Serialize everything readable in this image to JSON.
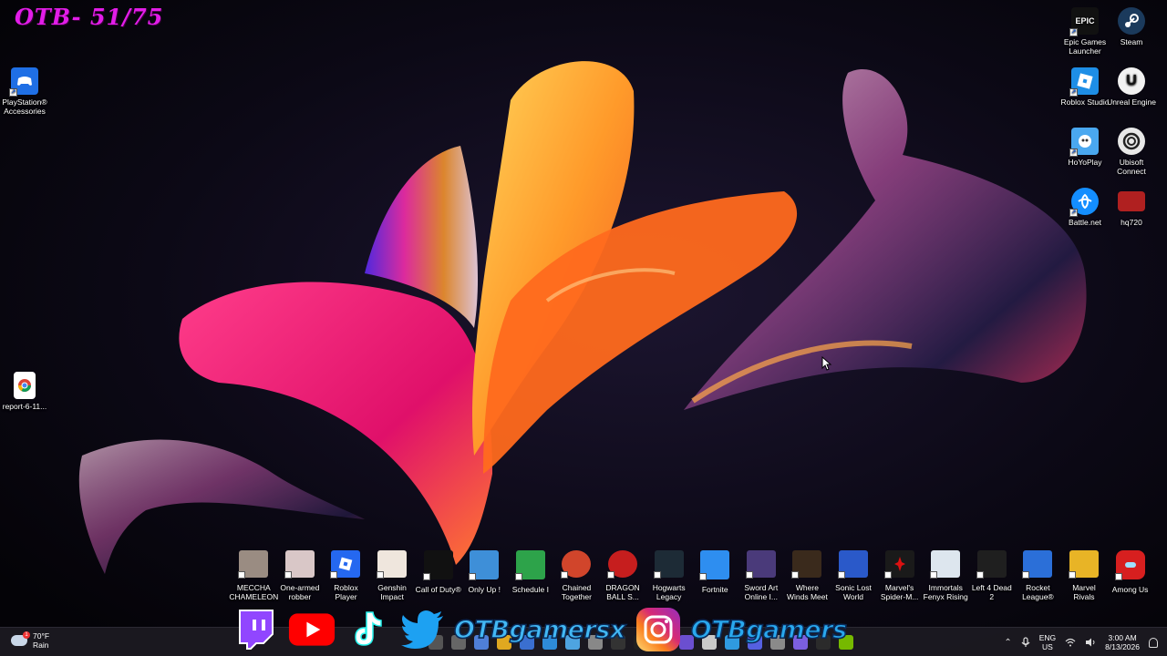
{
  "overlay": {
    "counter": "OTB- 51/75"
  },
  "desktop_left": [
    {
      "label": "PlayStation® Accessories",
      "icon": "playstation-accessories-icon",
      "color": "#1f6fe5"
    },
    {
      "label": "report-6-11...",
      "icon": "chrome-document-icon",
      "color": "#ffffff"
    }
  ],
  "desktop_right": [
    {
      "label": "Epic Games Launcher",
      "icon": "epic-games-icon",
      "color": "#111111",
      "glyph": "EPIC"
    },
    {
      "label": "Steam",
      "icon": "steam-icon",
      "color": "#1b3a5c",
      "glyph": ""
    },
    {
      "label": "Roblox Studio",
      "icon": "roblox-studio-icon",
      "color": "#1e8ee6",
      "glyph": ""
    },
    {
      "label": "Unreal Engine",
      "icon": "unreal-engine-icon",
      "color": "#f2f2f2",
      "glyph": "U"
    },
    {
      "label": "HoYoPlay",
      "icon": "hoyoplay-icon",
      "color": "#4aa8f0",
      "glyph": ""
    },
    {
      "label": "Ubisoft Connect",
      "icon": "ubisoft-connect-icon",
      "color": "#e8e8e8",
      "glyph": ""
    },
    {
      "label": "Battle.net",
      "icon": "battlenet-icon",
      "color": "#148eff",
      "glyph": ""
    },
    {
      "label": "hq720",
      "icon": "image-thumbnail-icon",
      "color": "#b02020",
      "glyph": ""
    }
  ],
  "games": [
    {
      "label": "MECCHA CHAMELEON",
      "icon": "meccha-chameleon-icon",
      "color": "#9a8c82"
    },
    {
      "label": "One-armed robber",
      "icon": "one-armed-robber-icon",
      "color": "#d9c7c7"
    },
    {
      "label": "Roblox Player",
      "icon": "roblox-player-icon",
      "color": "#2568f0"
    },
    {
      "label": "Genshin Impact",
      "icon": "genshin-impact-icon",
      "color": "#efe6dd"
    },
    {
      "label": "Call of Duty®",
      "icon": "call-of-duty-icon",
      "color": "#111111"
    },
    {
      "label": "Only Up !",
      "icon": "only-up-icon",
      "color": "#3e8fd8"
    },
    {
      "label": "Schedule I",
      "icon": "schedule-i-icon",
      "color": "#2da34a"
    },
    {
      "label": "Chained Together",
      "icon": "chained-together-icon",
      "color": "#d1452b"
    },
    {
      "label": "DRAGON BALL S...",
      "icon": "dragon-ball-icon",
      "color": "#c61e1e"
    },
    {
      "label": "Hogwarts Legacy",
      "icon": "hogwarts-legacy-icon",
      "color": "#1d2b36"
    },
    {
      "label": "Fortnite",
      "icon": "fortnite-icon",
      "color": "#2e8ef0"
    },
    {
      "label": "Sword Art Online I...",
      "icon": "sword-art-online-icon",
      "color": "#4a3a7a"
    },
    {
      "label": "Where Winds Meet",
      "icon": "where-winds-meet-icon",
      "color": "#3a2a1c"
    },
    {
      "label": "Sonic Lost World",
      "icon": "sonic-lost-world-icon",
      "color": "#2a59c9"
    },
    {
      "label": "Marvel's Spider-M...",
      "icon": "spider-man-icon",
      "color": "#1a1a1a"
    },
    {
      "label": "Immortals Fenyx Rising",
      "icon": "immortals-fenyx-rising-icon",
      "color": "#dde6ee"
    },
    {
      "label": "Left 4 Dead 2",
      "icon": "left-4-dead-2-icon",
      "color": "#1f1f1f"
    },
    {
      "label": "Rocket League®",
      "icon": "rocket-league-icon",
      "color": "#2b6fd8"
    },
    {
      "label": "Marvel Rivals",
      "icon": "marvel-rivals-icon",
      "color": "#e8b426"
    },
    {
      "label": "Among Us",
      "icon": "among-us-icon",
      "color": "#d71f1f"
    }
  ],
  "social": {
    "twitter_handle": "OTBgamersx",
    "instagram_handle": "OTBgamers"
  },
  "taskbar": {
    "weather_temp": "70°F",
    "weather_desc": "Rain",
    "weather_badge": "1",
    "lang": "ENG",
    "region": "US",
    "time": "3:00 AM",
    "date": "8/13/2026",
    "tray_icons": [
      "chevron-up-icon",
      "microphone-icon",
      "wifi-icon",
      "speaker-icon",
      "notification-bell-icon"
    ],
    "pinned_colors": [
      "#555",
      "#666",
      "#4f7fd8",
      "#e0a820",
      "#3a6fd0",
      "#2e8cd8",
      "#4ea4e0",
      "#888",
      "#333",
      "#1f1f1f",
      "#777",
      "#6b4fd0",
      "#c9c9c9",
      "#2f9ae0",
      "#5560e0",
      "#8a8a8a",
      "#7b5fe0",
      "#2b2b2b",
      "#76b900"
    ]
  }
}
